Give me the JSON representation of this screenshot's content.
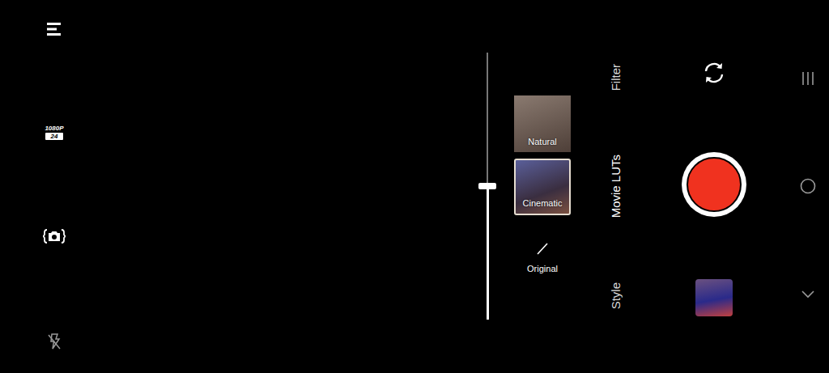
{
  "left_toolbar": {
    "resolution": "1080P",
    "frame_rate": "24",
    "flash": {
      "on": false
    }
  },
  "zoom_slider": {
    "level": 0.5
  },
  "filters": [
    {
      "label": "Natural",
      "kind": "thumbnail",
      "selected": false
    },
    {
      "label": "Cinematic",
      "kind": "thumbnail",
      "selected": true
    },
    {
      "label": "Original",
      "kind": "none",
      "selected": false
    }
  ],
  "modes": [
    {
      "label": "Filter",
      "selected": false
    },
    {
      "label": "Movie LUTs",
      "selected": true
    },
    {
      "label": "Style",
      "selected": false
    }
  ]
}
